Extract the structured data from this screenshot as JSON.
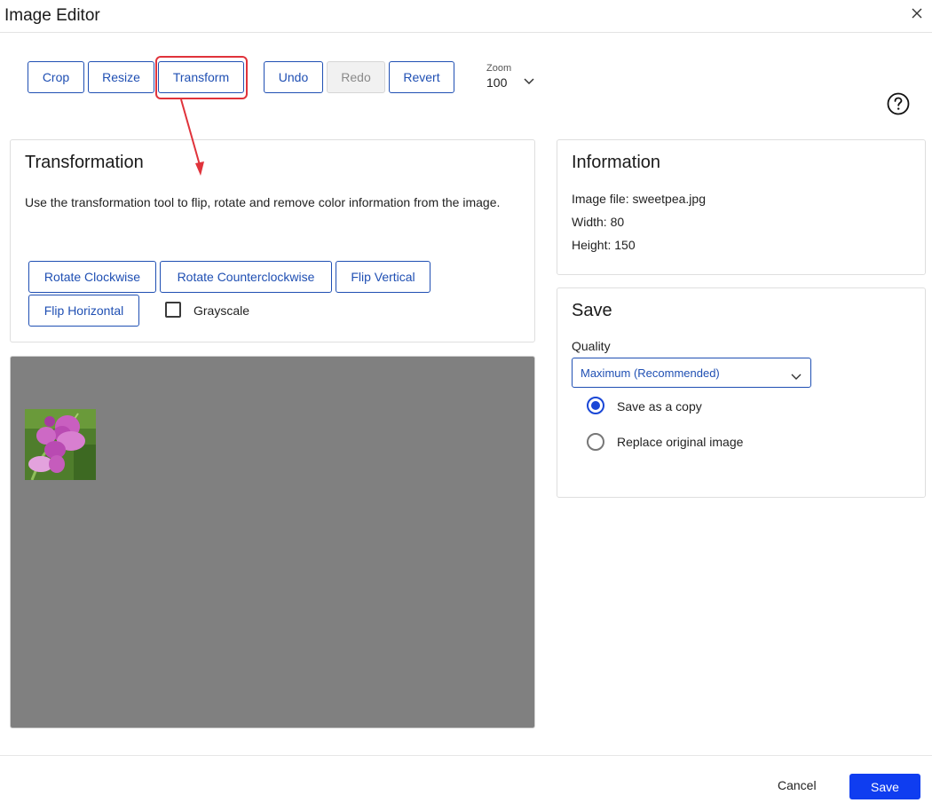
{
  "window": {
    "title": "Image Editor",
    "close_icon": "close-icon"
  },
  "toolbar": {
    "crop": "Crop",
    "resize": "Resize",
    "transform": "Transform",
    "undo": "Undo",
    "redo": "Redo",
    "revert": "Revert",
    "zoom_label": "Zoom",
    "zoom_value": "100",
    "active_tool": "Transform",
    "redo_disabled": true
  },
  "transformation": {
    "title": "Transformation",
    "description": "Use the transformation tool to flip, rotate and remove color information from the image.",
    "rotate_cw": "Rotate Clockwise",
    "rotate_ccw": "Rotate Counterclockwise",
    "flip_vertical": "Flip Vertical",
    "flip_horizontal": "Flip Horizontal",
    "grayscale_label": "Grayscale",
    "grayscale_checked": false
  },
  "information": {
    "title": "Information",
    "image_file": "Image file: sweetpea.jpg",
    "width": "Width: 80",
    "height": "Height: 150"
  },
  "save_panel": {
    "title": "Save",
    "quality_label": "Quality",
    "quality_value": "Maximum (Recommended)",
    "options": [
      {
        "label": "Save as a copy",
        "checked": true
      },
      {
        "label": "Replace original image",
        "checked": false
      }
    ]
  },
  "footer": {
    "cancel": "Cancel",
    "save": "Save"
  },
  "colors": {
    "accent": "#1f4fb3",
    "primary_button": "#0f3df0",
    "highlight": "#e0333b",
    "canvas": "#808080"
  }
}
